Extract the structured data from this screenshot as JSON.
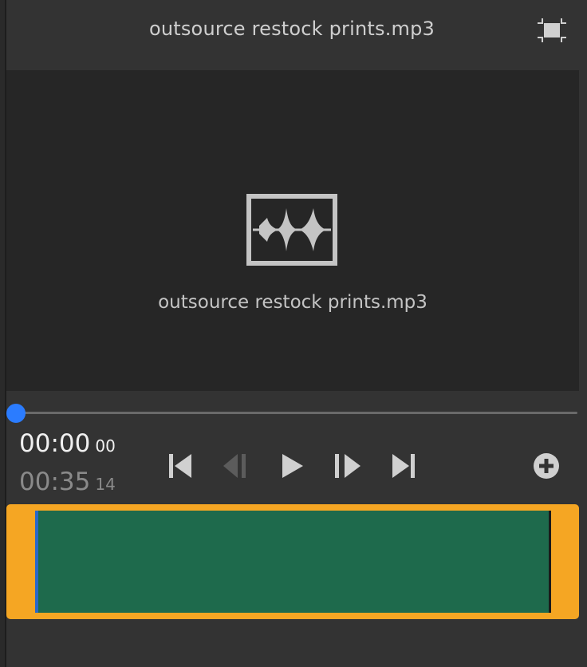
{
  "header": {
    "title": "outsource restock prints.mp3",
    "fullscreen_icon": "fullscreen-icon"
  },
  "preview": {
    "icon": "audio-file-icon",
    "filename": "outsource restock prints.mp3"
  },
  "playhead": {
    "position_fraction": 0.0
  },
  "timecode": {
    "current": "00:00",
    "current_frames": "00",
    "duration": "00:35",
    "duration_frames": "14"
  },
  "transport": {
    "icons": [
      "skip-to-start-icon",
      "step-back-icon",
      "play-icon",
      "step-forward-icon",
      "skip-to-end-icon"
    ]
  },
  "add": {
    "icon": "add-circle-icon"
  },
  "colors": {
    "accent": "#2b7cff",
    "clip_border": "#f5a623",
    "clip_fill": "#1e6a4c",
    "background": "#333333"
  }
}
